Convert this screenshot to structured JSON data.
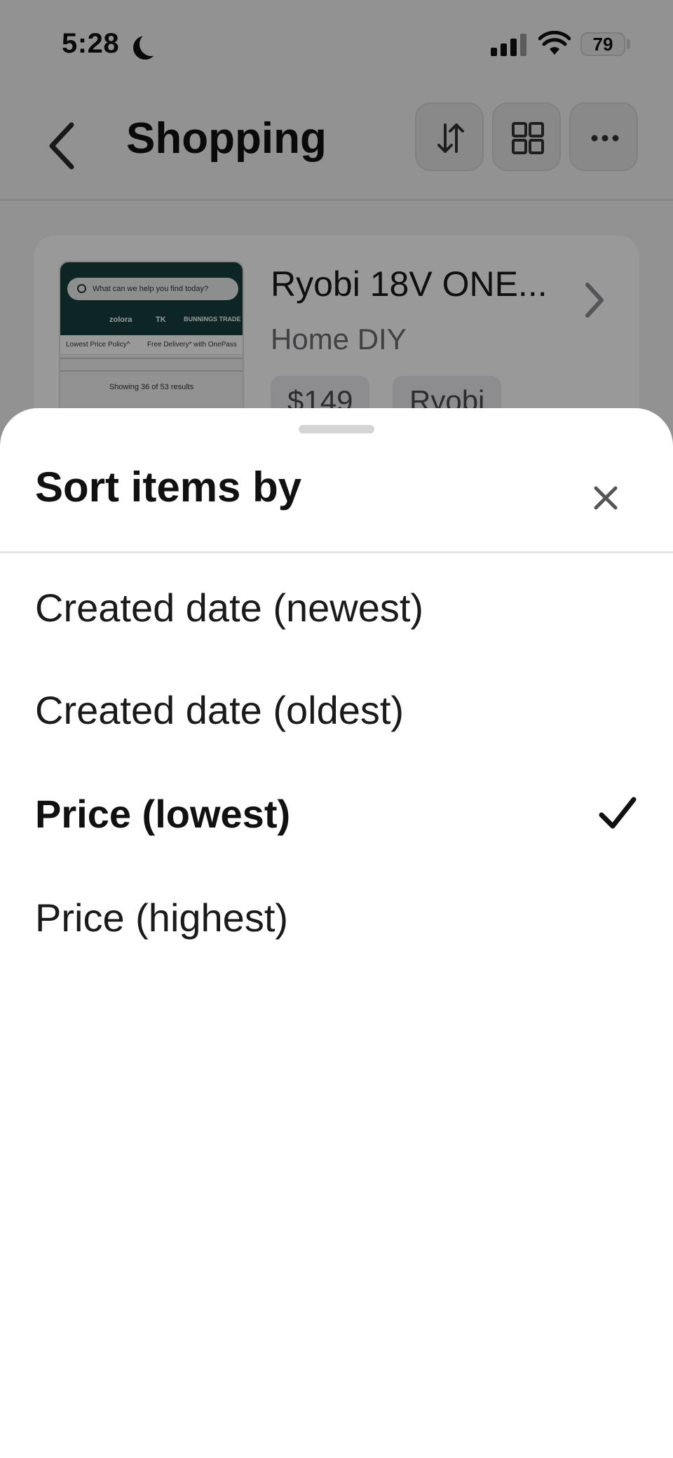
{
  "status_bar": {
    "time": "5:28",
    "battery_percent": "79",
    "signal_bars_active": 3,
    "signal_bars_total": 4
  },
  "nav": {
    "title": "Shopping",
    "actions": [
      {
        "icon": "sort-arrows-icon"
      },
      {
        "icon": "grid-view-icon"
      },
      {
        "icon": "more-dots-icon"
      }
    ]
  },
  "card": {
    "title": "Ryobi 18V ONE...",
    "subtitle": "Home DIY",
    "tags": [
      "$149",
      "Ryobi"
    ],
    "thumbnail": {
      "search_placeholder": "What can we help you find today?",
      "brands": [
        "zolora",
        "TK",
        "BUNNINGS TRADE"
      ],
      "strip_left": "Lowest Price Policy^",
      "strip_right": "Free Delivery* with OnePass",
      "results_text": "Showing 36 of 53 results"
    }
  },
  "sheet": {
    "title": "Sort items by",
    "close_icon": "close-icon",
    "options": [
      {
        "label": "Created date (newest)",
        "selected": false
      },
      {
        "label": "Created date (oldest)",
        "selected": false
      },
      {
        "label": "Price (lowest)",
        "selected": true
      },
      {
        "label": "Price (highest)",
        "selected": false
      }
    ]
  },
  "colors": {
    "overlay": "rgba(0,0,0,0.40)",
    "text_primary": "#111111",
    "thumb_header": "#17403f"
  }
}
